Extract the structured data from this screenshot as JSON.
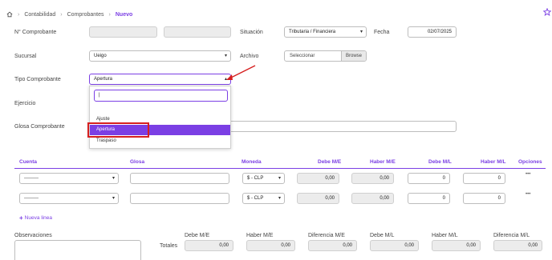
{
  "breadcrumb": {
    "items": [
      "Contabilidad",
      "Comprobantes"
    ],
    "current": "Nuevo"
  },
  "colors": {
    "accent": "#7b3fe4",
    "highlight_red": "#d61f1f",
    "selected_bg": "#7b3fe4"
  },
  "form": {
    "nro_label": "N° Comprobante",
    "situacion_label": "Situación",
    "situacion_value": "Tributaria / Financiera",
    "fecha_label": "Fecha",
    "fecha_value": "02/07/2025",
    "sucursal_label": "Sucursal",
    "sucursal_value": "Ueigo",
    "archivo_label": "Archivo",
    "archivo_button": "Seleccionar",
    "browse_button": "Browse",
    "tipo_label": "Tipo Comprobante",
    "tipo_value": "Apertura",
    "ejercicio_label": "Ejercicio",
    "glosa_label": "Glosa Comprobante"
  },
  "dropdown": {
    "search_value": "|",
    "options": [
      "Ajuste",
      "Apertura",
      "Traspaso"
    ],
    "selected": "Apertura"
  },
  "table": {
    "headers": {
      "cuenta": "Cuenta",
      "glosa": "Glosa",
      "moneda": "Moneda",
      "debe_me": "Debe M/E",
      "haber_me": "Haber M/E",
      "debe_ml": "Debe M/L",
      "haber_ml": "Haber M/L",
      "opciones": "Opciones"
    },
    "rows": [
      {
        "cuenta": "---------",
        "moneda": "$ - CLP",
        "debe_me": "0,00",
        "haber_me": "0,00",
        "debe_ml": "0",
        "haber_ml": "0",
        "opciones": "•••"
      },
      {
        "cuenta": "---------",
        "moneda": "$ - CLP",
        "debe_me": "0,00",
        "haber_me": "0,00",
        "debe_ml": "0",
        "haber_ml": "0",
        "opciones": "•••"
      }
    ],
    "add_line": "Nueva linea"
  },
  "footer": {
    "observaciones_label": "Observaciones",
    "totales_label": "Totales",
    "columns": [
      "Debe M/E",
      "Haber M/E",
      "Diferencia M/E",
      "Debe M/L",
      "Haber M/L",
      "Diferencia M/L"
    ],
    "values": [
      "0,00",
      "0,00",
      "0,00",
      "0,00",
      "0,00",
      "0,00"
    ]
  }
}
